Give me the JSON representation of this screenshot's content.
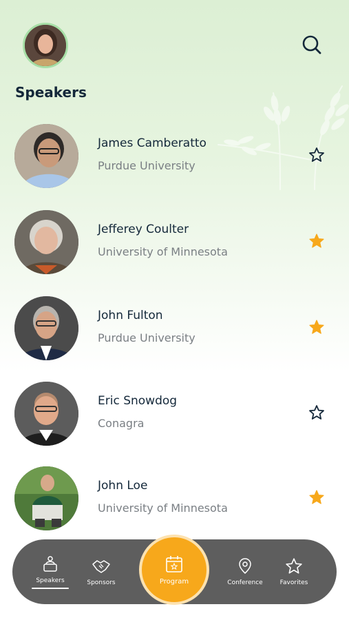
{
  "header": {
    "title": "Speakers"
  },
  "speakers": [
    {
      "name": "James Camberatto",
      "organization": "Purdue University",
      "favorite": false
    },
    {
      "name": "Jefferey Coulter",
      "organization": "University of Minnesota",
      "favorite": true
    },
    {
      "name": "John Fulton",
      "organization": "Purdue University",
      "favorite": true
    },
    {
      "name": "Eric Snowdog",
      "organization": "Conagra",
      "favorite": false
    },
    {
      "name": "John Loe",
      "organization": "University of Minnesota",
      "favorite": true
    }
  ],
  "tabbar": {
    "speakers_label": "Speakers",
    "sponsors_label": "Sponsors",
    "program_label": "Program",
    "conference_label": "Conference",
    "favorites_label": "Favorites",
    "active_tab": "Speakers"
  },
  "colors": {
    "accent": "#f7a81b",
    "tabbar": "#5e5e5e",
    "favorite_star": "#f7a81b",
    "avatar_ring": "#a6dfa6"
  }
}
